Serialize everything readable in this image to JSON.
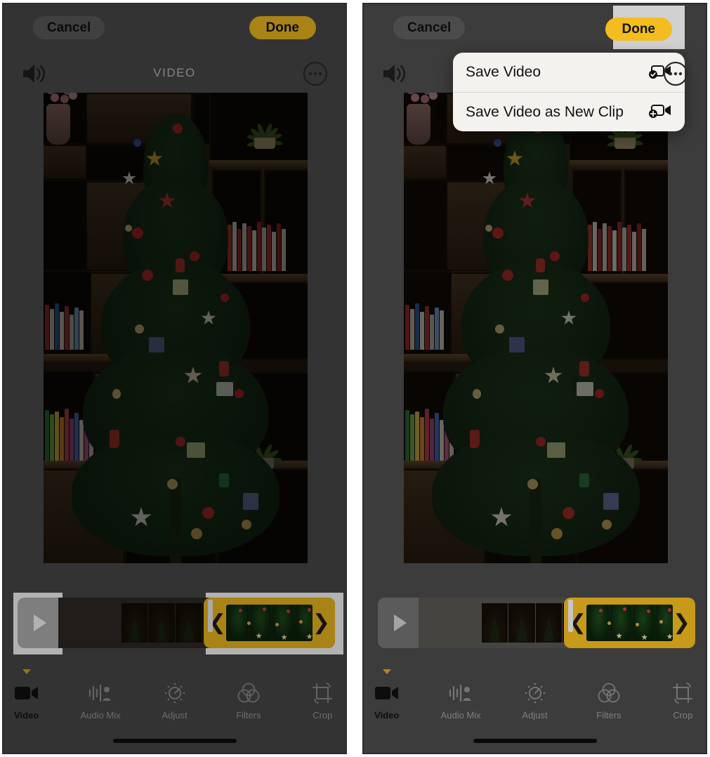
{
  "app": {
    "screen_title": "VIDEO",
    "accent_yellow": "#f3bc1f",
    "panel_bg": "#4a4a4a",
    "popup_bg": "#f4f2ee"
  },
  "topbar": {
    "cancel_label": "Cancel",
    "done_label": "Done",
    "speaker_icon": "speaker-wave-icon",
    "more_icon": "ellipsis-circle-icon"
  },
  "popup": {
    "items": [
      {
        "label": "Save Video",
        "icon": "video-camera-check-icon"
      },
      {
        "label": "Save Video as New Clip",
        "icon": "video-camera-plus-icon"
      }
    ]
  },
  "timeline": {
    "play_icon": "play-triangle-icon",
    "trim_left_handle": "❮",
    "trim_right_handle": "❯"
  },
  "tools": {
    "items": [
      {
        "label": "Video",
        "icon": "video-camera-icon",
        "active": true
      },
      {
        "label": "Audio Mix",
        "icon": "audio-mix-icon",
        "active": false
      },
      {
        "label": "Adjust",
        "icon": "adjust-dial-icon",
        "active": false
      },
      {
        "label": "Filters",
        "icon": "filters-circles-icon",
        "active": false
      },
      {
        "label": "Crop",
        "icon": "crop-rotate-icon",
        "active": false
      }
    ]
  },
  "panels": [
    {
      "id": "left",
      "name": "editor-before-tap",
      "dimmed": true,
      "popup_open": false
    },
    {
      "id": "right",
      "name": "editor-save-menu",
      "dimmed": true,
      "popup_open": true
    }
  ]
}
